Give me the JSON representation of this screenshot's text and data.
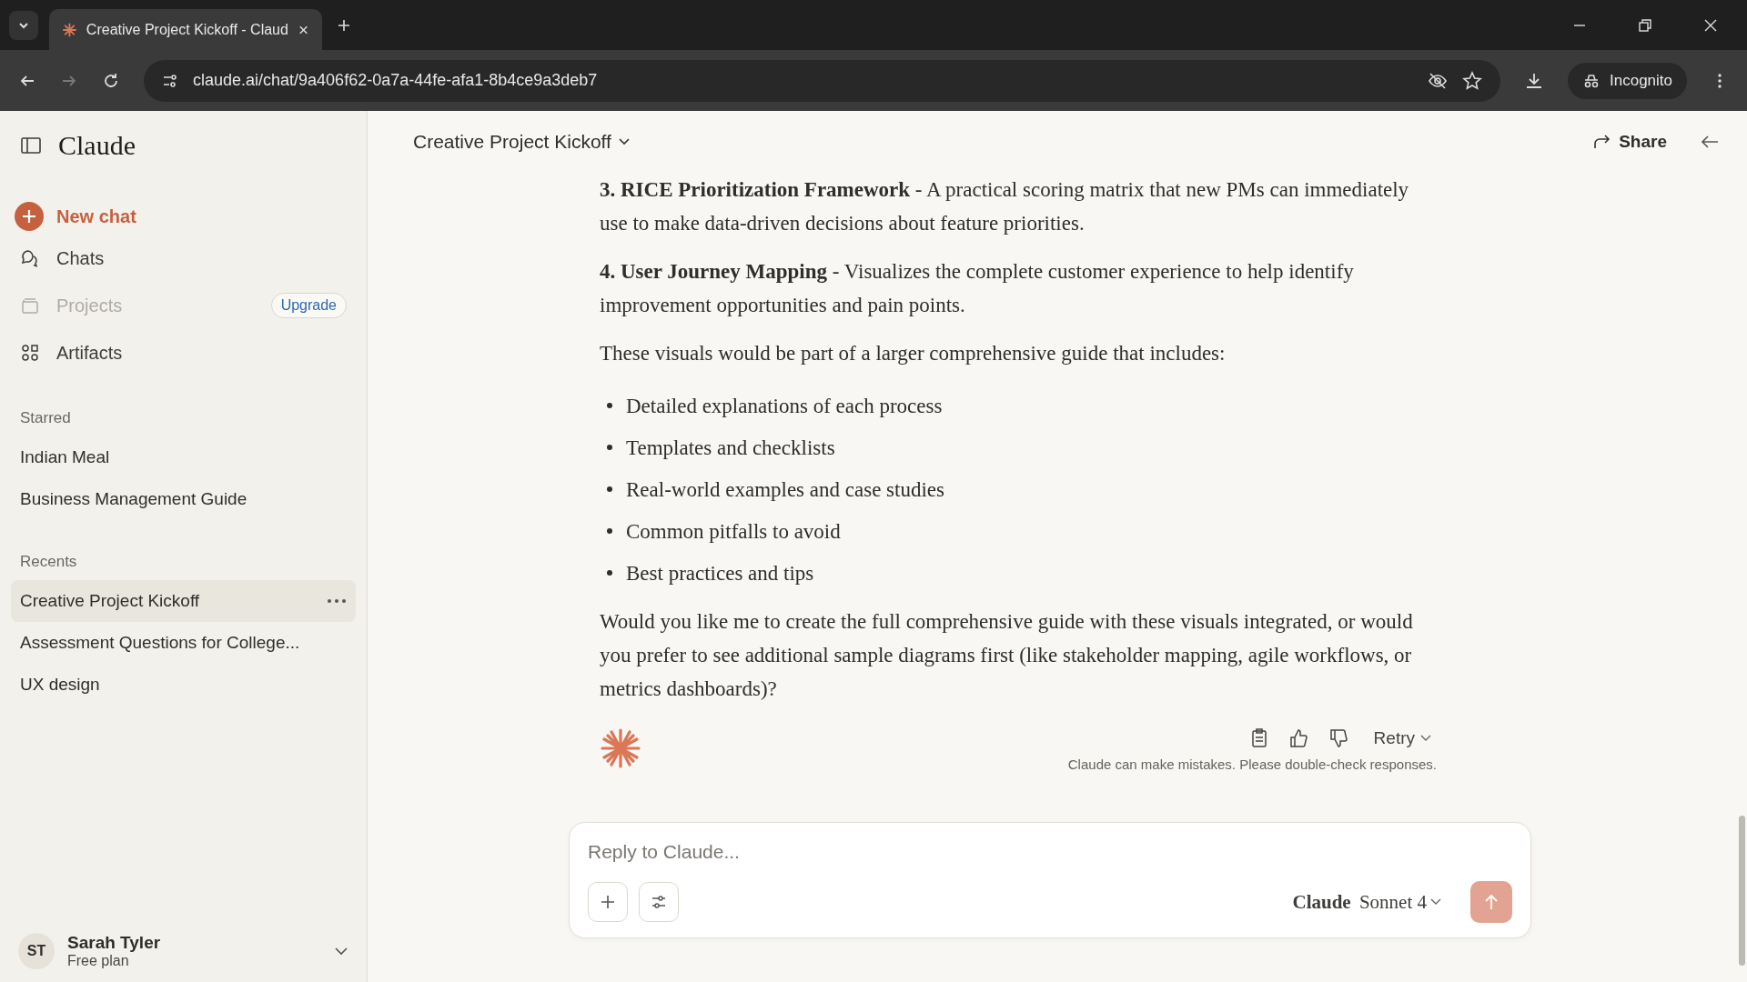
{
  "browser": {
    "tab_title": "Creative Project Kickoff - Claud",
    "url": "claude.ai/chat/9a406f62-0a7a-44fe-afa1-8b4ce9a3deb7",
    "profile": "Incognito"
  },
  "sidebar": {
    "logo": "Claude",
    "new_chat": "New chat",
    "nav": [
      {
        "label": "Chats",
        "disabled": false
      },
      {
        "label": "Projects",
        "disabled": true,
        "badge": "Upgrade"
      },
      {
        "label": "Artifacts",
        "disabled": false
      }
    ],
    "starred_heading": "Starred",
    "starred": [
      {
        "label": "Indian Meal"
      },
      {
        "label": "Business Management Guide"
      }
    ],
    "recents_heading": "Recents",
    "recents": [
      {
        "label": "Creative Project Kickoff",
        "selected": true
      },
      {
        "label": "Assessment Questions for College...",
        "selected": false
      },
      {
        "label": "UX design",
        "selected": false
      }
    ],
    "user": {
      "initials": "ST",
      "name": "Sarah Tyler",
      "plan": "Free plan"
    }
  },
  "header": {
    "title": "Creative Project Kickoff",
    "share": "Share"
  },
  "message": {
    "blocks": [
      {
        "kind": "paragraph",
        "text": "**3. RICE Prioritization Framework** - A practical scoring matrix that new PMs can immediately use to make data-driven decisions about feature priorities."
      },
      {
        "kind": "paragraph",
        "text": "**4. User Journey Mapping** - Visualizes the complete customer experience to help identify improvement opportunities and pain points."
      },
      {
        "kind": "paragraph",
        "text": "These visuals would be part of a larger comprehensive guide that includes:"
      },
      {
        "kind": "bullets",
        "items": [
          "Detailed explanations of each process",
          "Templates and checklists",
          "Real-world examples and case studies",
          "Common pitfalls to avoid",
          "Best practices and tips"
        ]
      },
      {
        "kind": "paragraph",
        "text": "Would you like me to create the full comprehensive guide with these visuals integrated, or would you prefer to see additional sample diagrams first (like stakeholder mapping, agile workflows, or metrics dashboards)?"
      }
    ],
    "retry": "Retry",
    "disclaimer": "Claude can make mistakes. Please double-check responses."
  },
  "composer": {
    "placeholder": "Reply to Claude...",
    "model_brand": "Claude",
    "model_name": "Sonnet 4"
  }
}
